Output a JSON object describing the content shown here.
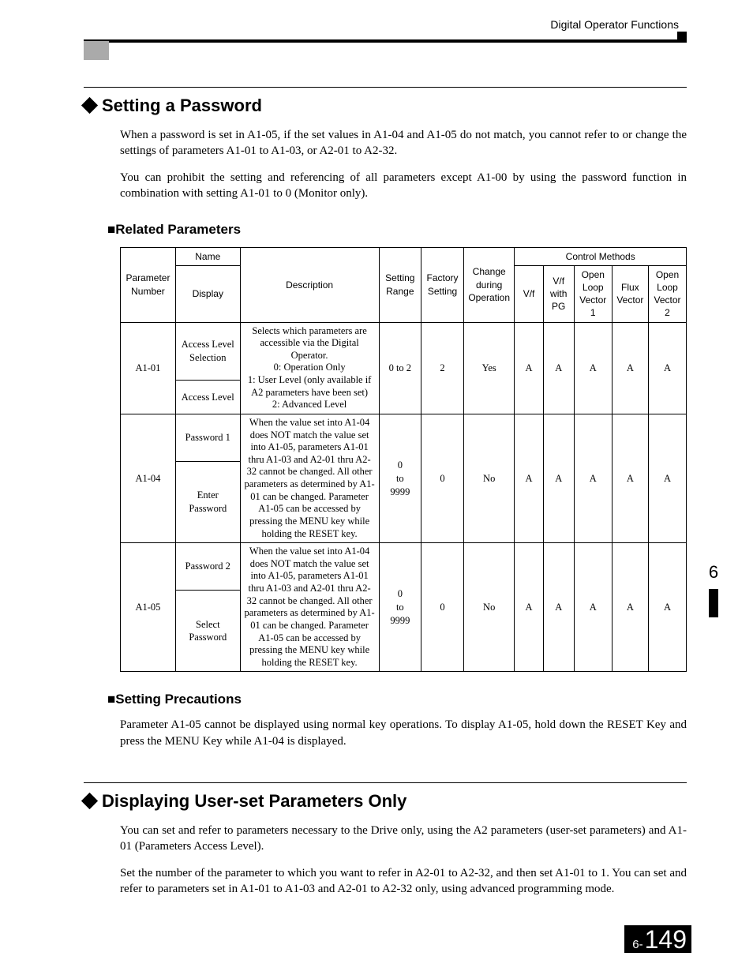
{
  "header": {
    "running_title": "Digital Operator Functions"
  },
  "side_tab": {
    "chapter": "6"
  },
  "footer": {
    "prefix": "6-",
    "page": "149"
  },
  "sec1": {
    "title": "Setting a Password",
    "p1": "When a password is set in A1-05, if the set values in A1-04 and A1-05 do not match, you cannot refer to or change the settings of parameters A1-01 to A1-03, or A2-01 to A2-32.",
    "p2": "You can prohibit the setting and referencing of all parameters except A1-00 by using the password function in combination with setting A1-01 to 0 (Monitor only).",
    "sub1": "■Related Parameters",
    "table": {
      "head": {
        "param_no": "Parameter Number",
        "name_group": "Name",
        "display": "Display",
        "description": "Description",
        "setting_range": "Setting Range",
        "factory_setting": "Factory Setting",
        "change": "Change during Operation",
        "control_methods": "Control Methods",
        "cm": {
          "vf": "V/f",
          "vfpg": "V/f with PG",
          "olv1": "Open Loop Vector 1",
          "flux": "Flux Vector",
          "olv2": "Open Loop Vector 2"
        }
      },
      "rows": [
        {
          "no": "A1-01",
          "name": "Access Level Selection",
          "display": "Access Level",
          "desc": "Selects which parameters are accessible via the Digital Operator.\n0: Operation Only\n1: User Level (only available if A2 parameters have been set)\n2: Advanced Level",
          "range": "0 to 2",
          "factory": "2",
          "change": "Yes",
          "cm": [
            "A",
            "A",
            "A",
            "A",
            "A"
          ]
        },
        {
          "no": "A1-04",
          "name": "Password 1",
          "display": "Enter Password",
          "desc": "When the value set into A1-04 does NOT match the value set into A1-05, parameters A1-01 thru A1-03 and A2-01 thru A2-32 cannot be changed. All other parameters as determined by A1-01 can be changed. Parameter A1-05 can be accessed by pressing the MENU key while holding the RESET key.",
          "range": "0\nto\n9999",
          "factory": "0",
          "change": "No",
          "cm": [
            "A",
            "A",
            "A",
            "A",
            "A"
          ]
        },
        {
          "no": "A1-05",
          "name": "Password 2",
          "display": "Select Password",
          "desc": "When the value set into A1-04 does NOT match the value set into A1-05, parameters A1-01 thru A1-03 and A2-01 thru A2-32 cannot be changed. All other parameters as determined by A1-01 can be changed. Parameter A1-05 can be accessed by pressing the MENU key while holding the RESET key.",
          "range": "0\nto\n9999",
          "factory": "0",
          "change": "No",
          "cm": [
            "A",
            "A",
            "A",
            "A",
            "A"
          ]
        }
      ]
    },
    "sub2": "■Setting Precautions",
    "p3": "Parameter A1-05 cannot be displayed using normal key operations. To display A1-05, hold down the RESET Key and press the MENU Key while A1-04 is displayed."
  },
  "sec2": {
    "title": "Displaying User-set Parameters Only",
    "p1": "You can set and refer to parameters necessary to the Drive only, using the A2 parameters (user-set parameters) and A1-01 (Parameters Access Level).",
    "p2": "Set the number of the parameter to which you want to refer in A2-01 to A2-32, and then set A1-01 to 1. You can set and refer to parameters set in A1-01 to A1-03 and A2-01 to A2-32 only, using advanced programming mode."
  }
}
